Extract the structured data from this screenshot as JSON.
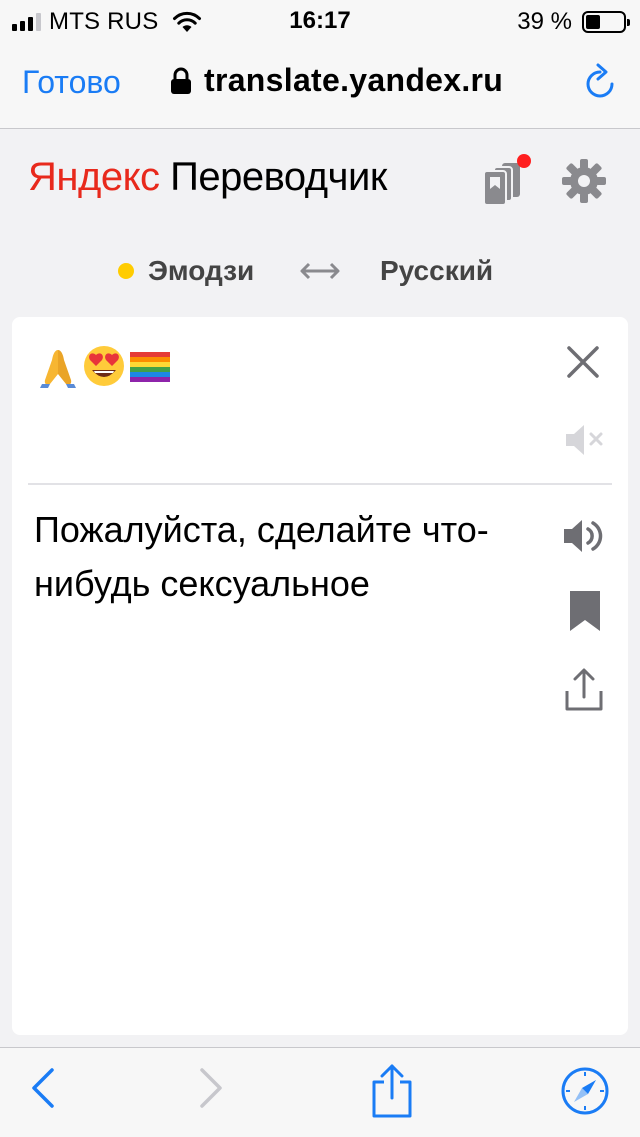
{
  "status_bar": {
    "carrier": "MTS RUS",
    "time": "16:17",
    "battery_percent": "39 %",
    "battery_level": 0.39,
    "signal_bars_filled": 3,
    "signal_bars_total": 4
  },
  "browser": {
    "done_label": "Готово",
    "url": "translate.yandex.ru",
    "accent_color": "#1a7cf5",
    "icons": [
      "lock-icon",
      "reload-icon"
    ]
  },
  "header": {
    "logo_brand": "Яндекс",
    "logo_product": "Переводчик",
    "brand_color": "#e8291c",
    "icons": [
      "bookmarks-icon",
      "settings-icon"
    ]
  },
  "languages": {
    "source": "Эмодзи",
    "target": "Русский",
    "source_dot_color": "#ffcc00",
    "swap_icon": "swap-arrows-icon"
  },
  "card": {
    "source_emojis": [
      "folded-hands-emoji",
      "heart-eyes-emoji",
      "rainbow-flag-emoji"
    ],
    "translation": "Пожалуйста, сделайте что-нибудь сексуальное",
    "source_actions": [
      "clear-icon",
      "mute-icon"
    ],
    "translation_actions": [
      "speaker-icon",
      "bookmark-icon",
      "share-icon"
    ]
  },
  "toolbar": {
    "icons": [
      "back-icon",
      "forward-icon",
      "share-icon",
      "compass-icon"
    ]
  }
}
